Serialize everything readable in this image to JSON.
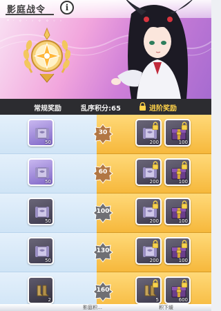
{
  "header": {
    "title": "影庭战令",
    "info_label": "i",
    "subline": "* · ✧ · ◦ ✧ ✧ ◦ ◦",
    "accent": "#f2a6dd"
  },
  "columns": {
    "free_label": "常规奖励",
    "score_label": "乱序积分:65",
    "premium_label": "进阶奖励"
  },
  "rows": [
    {
      "level": "30",
      "free": {
        "qty": "50",
        "style": "purple"
      },
      "premium": [
        {
          "qty": "200"
        },
        {
          "qty": "100"
        }
      ],
      "badge_color": "#b27744"
    },
    {
      "level": "60",
      "free": {
        "qty": "50",
        "style": "purple"
      },
      "premium": [
        {
          "qty": "200"
        },
        {
          "qty": "100"
        }
      ],
      "badge_color": "#b27744"
    },
    {
      "level": "100",
      "free": {
        "qty": "50",
        "style": "dark"
      },
      "premium": [
        {
          "qty": "200"
        },
        {
          "qty": "100"
        }
      ],
      "badge_color": "#6f6f74"
    },
    {
      "level": "130",
      "free": {
        "qty": "50",
        "style": "dark"
      },
      "premium": [
        {
          "qty": "200"
        },
        {
          "qty": "100"
        }
      ],
      "badge_color": "#6f6f74"
    },
    {
      "level": "160",
      "free": {
        "qty": "2",
        "style": "dark2"
      },
      "premium": [
        {
          "qty": "5"
        },
        {
          "qty": "600"
        }
      ],
      "badge_color": "#6f6f74"
    }
  ],
  "footer": {
    "left": "影庭积…",
    "right": "积下缓"
  }
}
